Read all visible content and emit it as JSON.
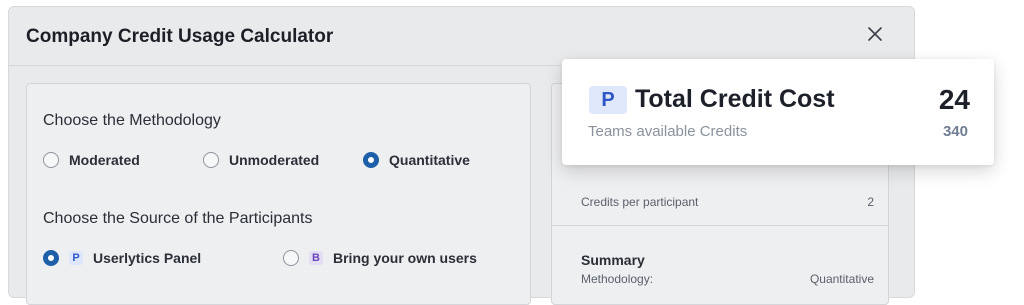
{
  "modal": {
    "title": "Company Credit Usage Calculator",
    "close_icon": "close-icon"
  },
  "methodology": {
    "label": "Choose the Methodology",
    "options": [
      {
        "label": "Moderated",
        "checked": false
      },
      {
        "label": "Unmoderated",
        "checked": false
      },
      {
        "label": "Quantitative",
        "checked": true
      }
    ]
  },
  "source": {
    "label": "Choose the Source of the Participants",
    "options": [
      {
        "tag": "P",
        "label": "Userlytics Panel",
        "checked": true
      },
      {
        "tag": "B",
        "label": "Bring your own users",
        "checked": false
      }
    ]
  },
  "summary_panel": {
    "credits_per_participant_label": "Credits per participant",
    "credits_per_participant_value": "2",
    "summary_title": "Summary",
    "methodology_label": "Methodology:",
    "methodology_value": "Quantitative"
  },
  "total_card": {
    "badge": "P",
    "title": "Total Credit Cost",
    "total": "24",
    "subtitle": "Teams available Credits",
    "available": "340"
  },
  "colors": {
    "accent": "#1d5fa8",
    "panel_tag_bg": "#dde6fb",
    "byou_tag_bg": "#e4ddf6"
  }
}
